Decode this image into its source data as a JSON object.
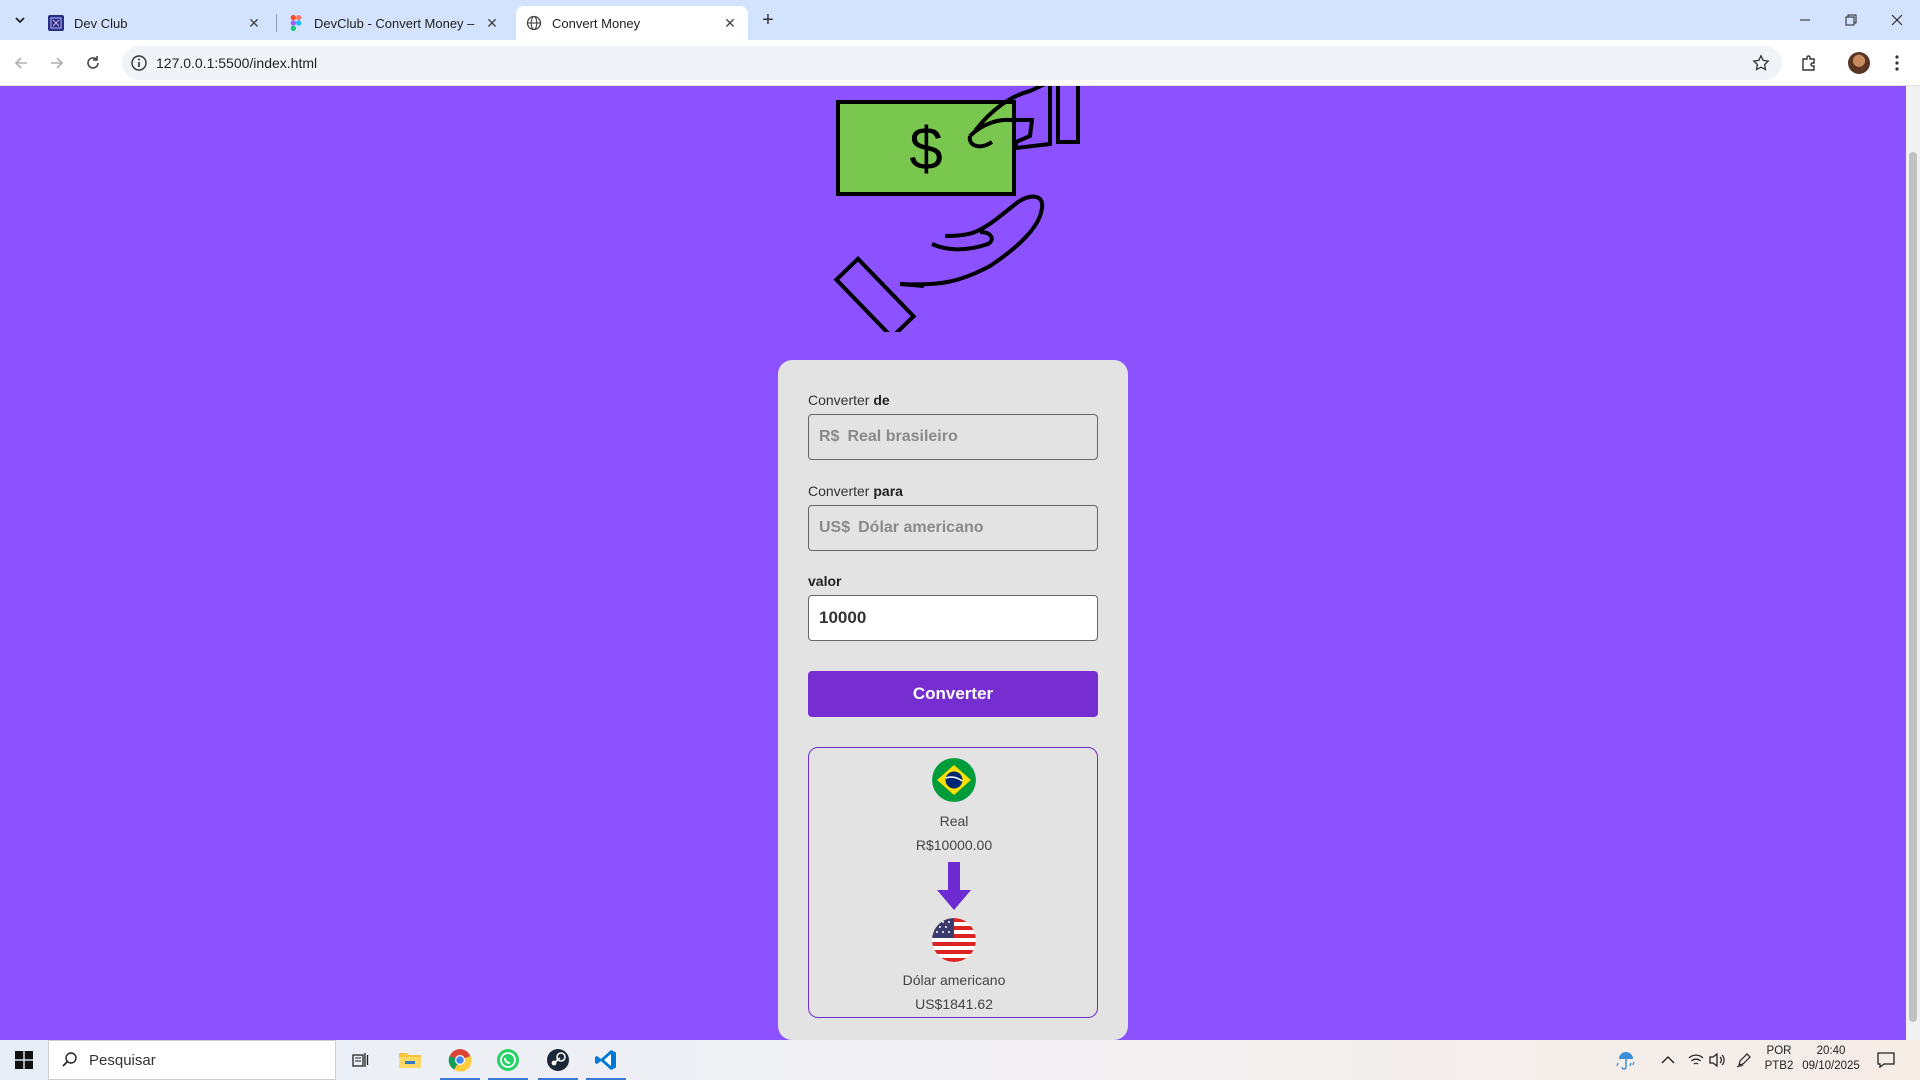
{
  "browser": {
    "tabs": [
      {
        "title": "Dev Club",
        "active": false
      },
      {
        "title": "DevClub - Convert Money – Fig",
        "active": false
      },
      {
        "title": "Convert Money",
        "active": true
      }
    ],
    "url": "127.0.0.1:5500/index.html"
  },
  "page": {
    "from_label": "Converter",
    "from_label_bold": "de",
    "from_currency_symbol": "R$",
    "from_currency_name": "Real brasileiro",
    "to_label": "Converter",
    "to_label_bold": "para",
    "to_currency_symbol": "US$",
    "to_currency_name": "Dólar americano",
    "value_label": "valor",
    "value": "10000",
    "convert_button": "Converter",
    "result": {
      "from_name": "Real",
      "from_value": "R$10000.00",
      "to_name": "Dólar americano",
      "to_value": "US$1841.62"
    }
  },
  "taskbar": {
    "search_placeholder": "Pesquisar",
    "language": "POR",
    "layout": "PTB2",
    "time": "20:40",
    "date": "09/10/2025"
  },
  "colors": {
    "page_background": "#8c52ff",
    "card_background": "#e3e3e3",
    "button": "#772ed1",
    "accent_border": "#6b2fc7",
    "chrome_tabbar": "#d3e3fd"
  },
  "icons": {
    "hero": "money-hand-illustration-icon",
    "from_flag": "brazil-flag-icon",
    "to_flag": "usa-flag-icon",
    "arrow": "arrow-down-icon"
  }
}
